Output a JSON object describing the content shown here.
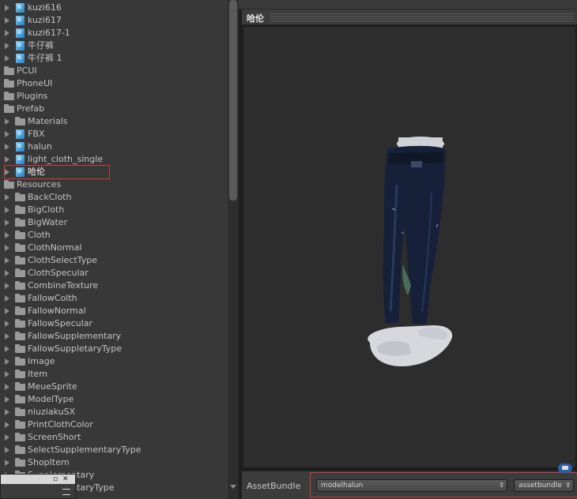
{
  "project_tree": {
    "items": [
      {
        "label": "kuzi616",
        "type": "prefab",
        "level": 1
      },
      {
        "label": "kuzi617",
        "type": "prefab",
        "level": 1
      },
      {
        "label": "kuzi617-1",
        "type": "prefab",
        "level": 1
      },
      {
        "label": "牛仔裤",
        "type": "prefab",
        "level": 1
      },
      {
        "label": "牛仔裤 1",
        "type": "prefab",
        "level": 1
      },
      {
        "label": "PCUI",
        "type": "folder",
        "level": 0
      },
      {
        "label": "PhoneUI",
        "type": "folder",
        "level": 0
      },
      {
        "label": "Plugins",
        "type": "folder",
        "level": 0
      },
      {
        "label": "Prefab",
        "type": "folder",
        "level": 0
      },
      {
        "label": "Materials",
        "type": "folder",
        "level": 1
      },
      {
        "label": "FBX",
        "type": "prefab",
        "level": 1
      },
      {
        "label": "halun",
        "type": "prefab",
        "level": 1
      },
      {
        "label": "light_cloth_single",
        "type": "prefab",
        "level": 1
      },
      {
        "label": "哈伦",
        "type": "prefab",
        "level": 1,
        "selected": true
      },
      {
        "label": "Resources",
        "type": "folder",
        "level": 0
      },
      {
        "label": "BackCloth",
        "type": "folder",
        "level": 1
      },
      {
        "label": "BigCloth",
        "type": "folder",
        "level": 1
      },
      {
        "label": "BigWater",
        "type": "folder",
        "level": 1
      },
      {
        "label": "Cloth",
        "type": "folder",
        "level": 1
      },
      {
        "label": "ClothNormal",
        "type": "folder",
        "level": 1
      },
      {
        "label": "ClothSelectType",
        "type": "folder",
        "level": 1
      },
      {
        "label": "ClothSpecular",
        "type": "folder",
        "level": 1
      },
      {
        "label": "CombineTexture",
        "type": "folder",
        "level": 1
      },
      {
        "label": "FallowColth",
        "type": "folder",
        "level": 1
      },
      {
        "label": "FallowNormal",
        "type": "folder",
        "level": 1
      },
      {
        "label": "FallowSpecular",
        "type": "folder",
        "level": 1
      },
      {
        "label": "FallowSupplementary",
        "type": "folder",
        "level": 1
      },
      {
        "label": "FallowSuppletaryType",
        "type": "folder",
        "level": 1
      },
      {
        "label": "Image",
        "type": "folder",
        "level": 1
      },
      {
        "label": "Item",
        "type": "folder",
        "level": 1
      },
      {
        "label": "MeueSprite",
        "type": "folder",
        "level": 1
      },
      {
        "label": "ModelType",
        "type": "folder",
        "level": 1
      },
      {
        "label": "niuziakuSX",
        "type": "folder",
        "level": 1
      },
      {
        "label": "PrintClothColor",
        "type": "folder",
        "level": 1
      },
      {
        "label": "ScreenShort",
        "type": "folder",
        "level": 1
      },
      {
        "label": "SelectSupplementaryType",
        "type": "folder",
        "level": 1
      },
      {
        "label": "ShopItem",
        "type": "folder",
        "level": 1
      },
      {
        "label": "Supplementary",
        "type": "folder",
        "level": 1
      },
      {
        "label": "SupplementaryType",
        "type": "folder",
        "level": 1
      }
    ]
  },
  "mini_window": {
    "maximize": "▫",
    "close": "✕"
  },
  "preview": {
    "title": "哈伦",
    "model_colors": {
      "denim": "#16213a",
      "mannequin": "#d9dbe0"
    }
  },
  "asset_bundle": {
    "label": "AssetBundle",
    "name_value": "modelhalun",
    "variant_value": "assetbundle",
    "dropdown_arrow": "⇕"
  },
  "colors": {
    "highlight_outline": "#d23a3a",
    "panel_bg": "#383838",
    "preview_bg": "#2d2d2d"
  }
}
